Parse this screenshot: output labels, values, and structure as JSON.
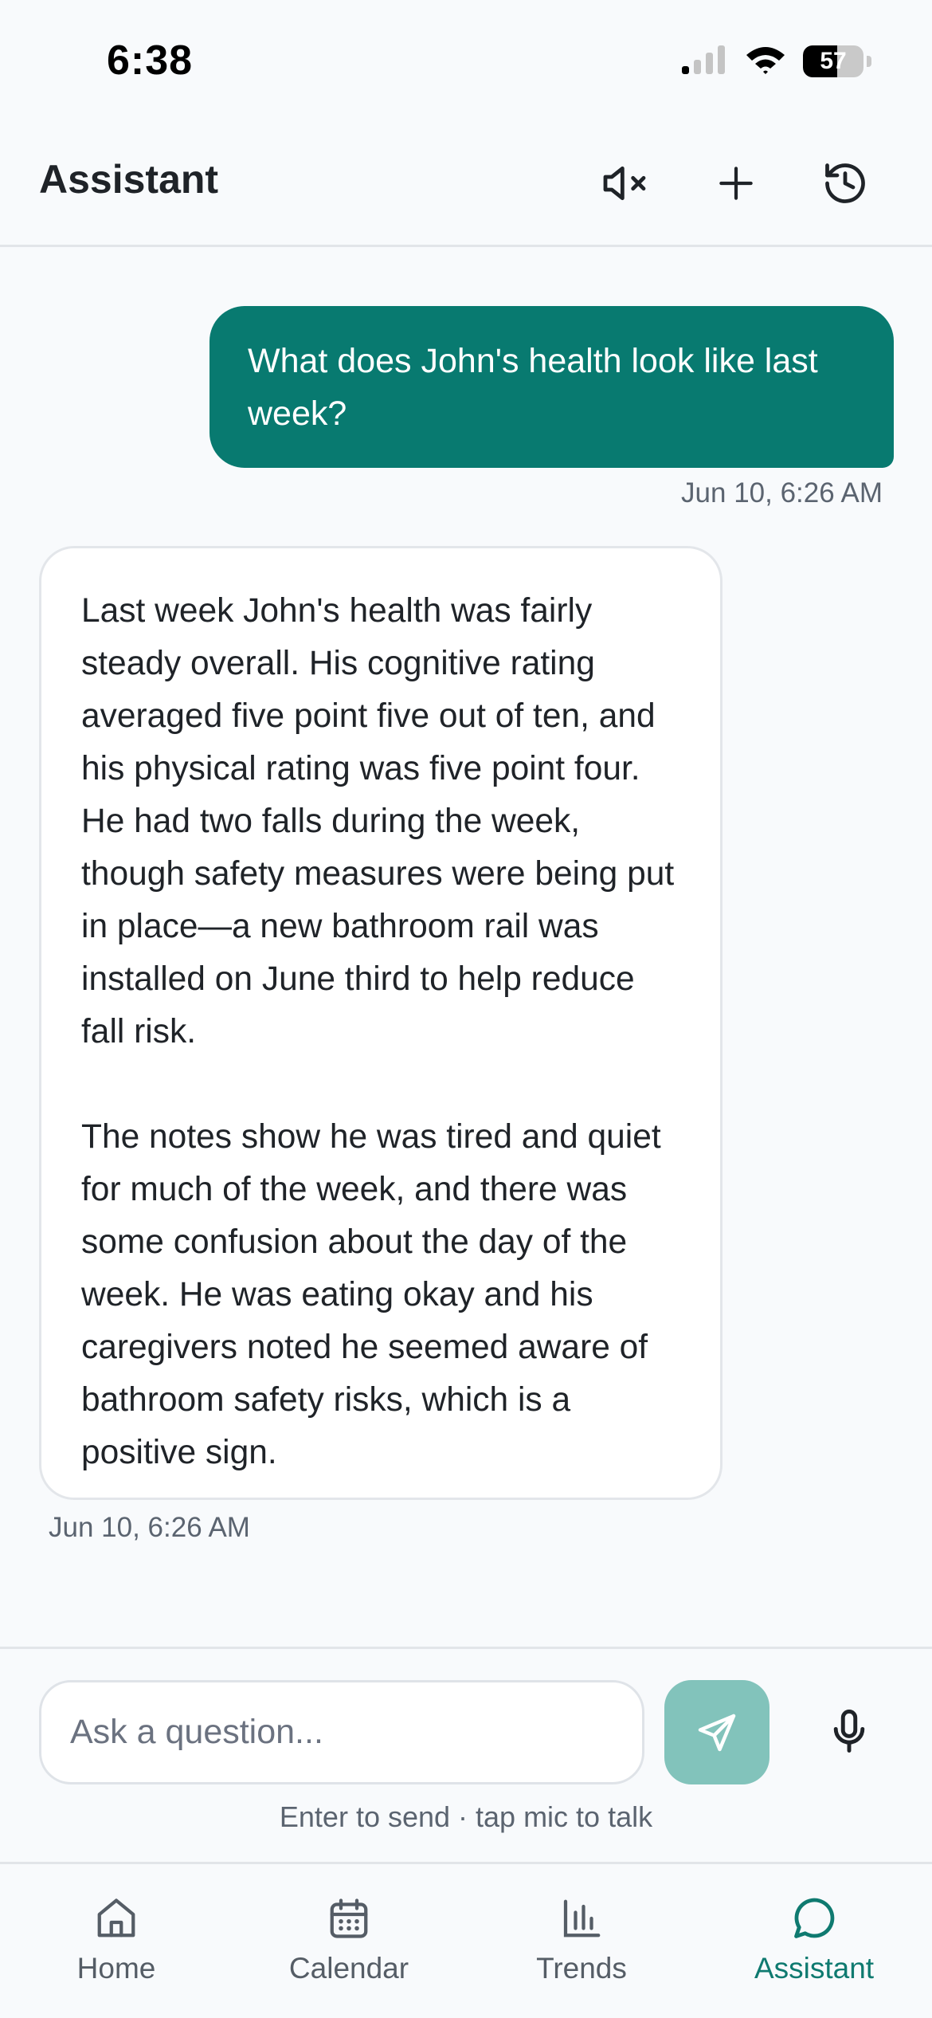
{
  "status_bar": {
    "time": "6:38",
    "battery": "57",
    "battery_level": 0.57
  },
  "header": {
    "title": "Assistant",
    "icons": [
      "speaker-muted-icon",
      "plus-icon",
      "history-icon"
    ]
  },
  "conversation": {
    "user_message": {
      "text": "What does John's health look like last week?",
      "timestamp": "Jun 10, 6:26 AM"
    },
    "assistant_message": {
      "paragraphs": [
        "Last week John's health was fairly steady overall. His cognitive rating averaged five point five out of ten, and his physical rating was five point four. He had two falls during the week, though safety measures were being put in place—a new bathroom rail was installed on June third to help reduce fall risk.",
        "The notes show he was tired and quiet for much of the week, and there was some confusion about the day of the week. He was eating okay and his caregivers noted he seemed aware of bathroom safety risks, which is a positive sign."
      ],
      "timestamp": "Jun 10, 6:26 AM"
    }
  },
  "composer": {
    "placeholder": "Ask a question...",
    "value": "",
    "hint": "Enter to send · tap mic to talk"
  },
  "tab_bar": {
    "items": [
      {
        "label": "Home",
        "icon": "home-icon"
      },
      {
        "label": "Calendar",
        "icon": "calendar-icon"
      },
      {
        "label": "Trends",
        "icon": "bar-chart-icon"
      },
      {
        "label": "Assistant",
        "icon": "chat-bubble-icon",
        "active": true
      }
    ]
  },
  "colors": {
    "accent": "#087a70",
    "send_button": "#82c3bb",
    "background": "#f8fafc",
    "active_tab": "#0f7a70"
  }
}
